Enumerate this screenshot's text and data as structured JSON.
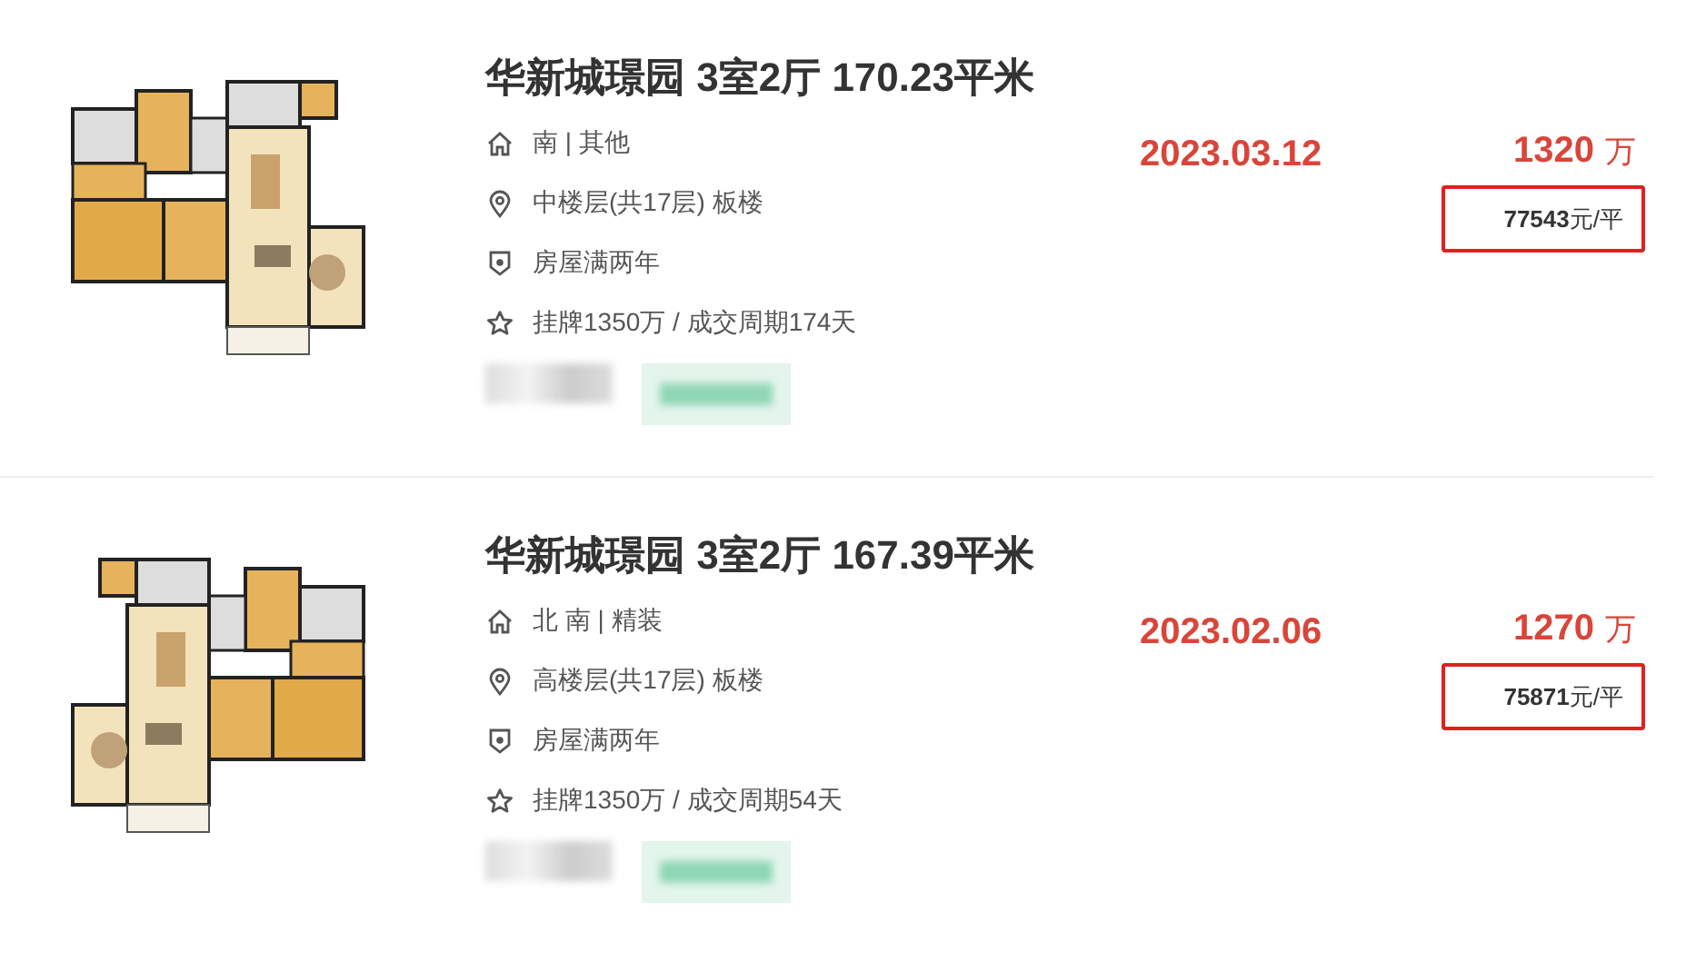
{
  "listings": [
    {
      "title": "华新城璟园 3室2厅 170.23平米",
      "details": [
        {
          "kind": "house",
          "text": "南 | 其他"
        },
        {
          "kind": "location",
          "text": "中楼层(共17层) 板楼"
        },
        {
          "kind": "shield",
          "text": "房屋满两年"
        },
        {
          "kind": "star",
          "text": "挂牌1350万 / 成交周期174天"
        }
      ],
      "date": "2023.03.12",
      "price": "1320",
      "price_unit": "万",
      "unit_price": "**77543**元/平"
    },
    {
      "title": "华新城璟园 3室2厅 167.39平米",
      "details": [
        {
          "kind": "house",
          "text": "北 南 | 精装"
        },
        {
          "kind": "location",
          "text": "高楼层(共17层) 板楼"
        },
        {
          "kind": "shield",
          "text": "房屋满两年"
        },
        {
          "kind": "star",
          "text": "挂牌1350万 / 成交周期54天"
        }
      ],
      "date": "2023.02.06",
      "price": "1270",
      "price_unit": "万",
      "unit_price": "**75871**元/平"
    }
  ]
}
